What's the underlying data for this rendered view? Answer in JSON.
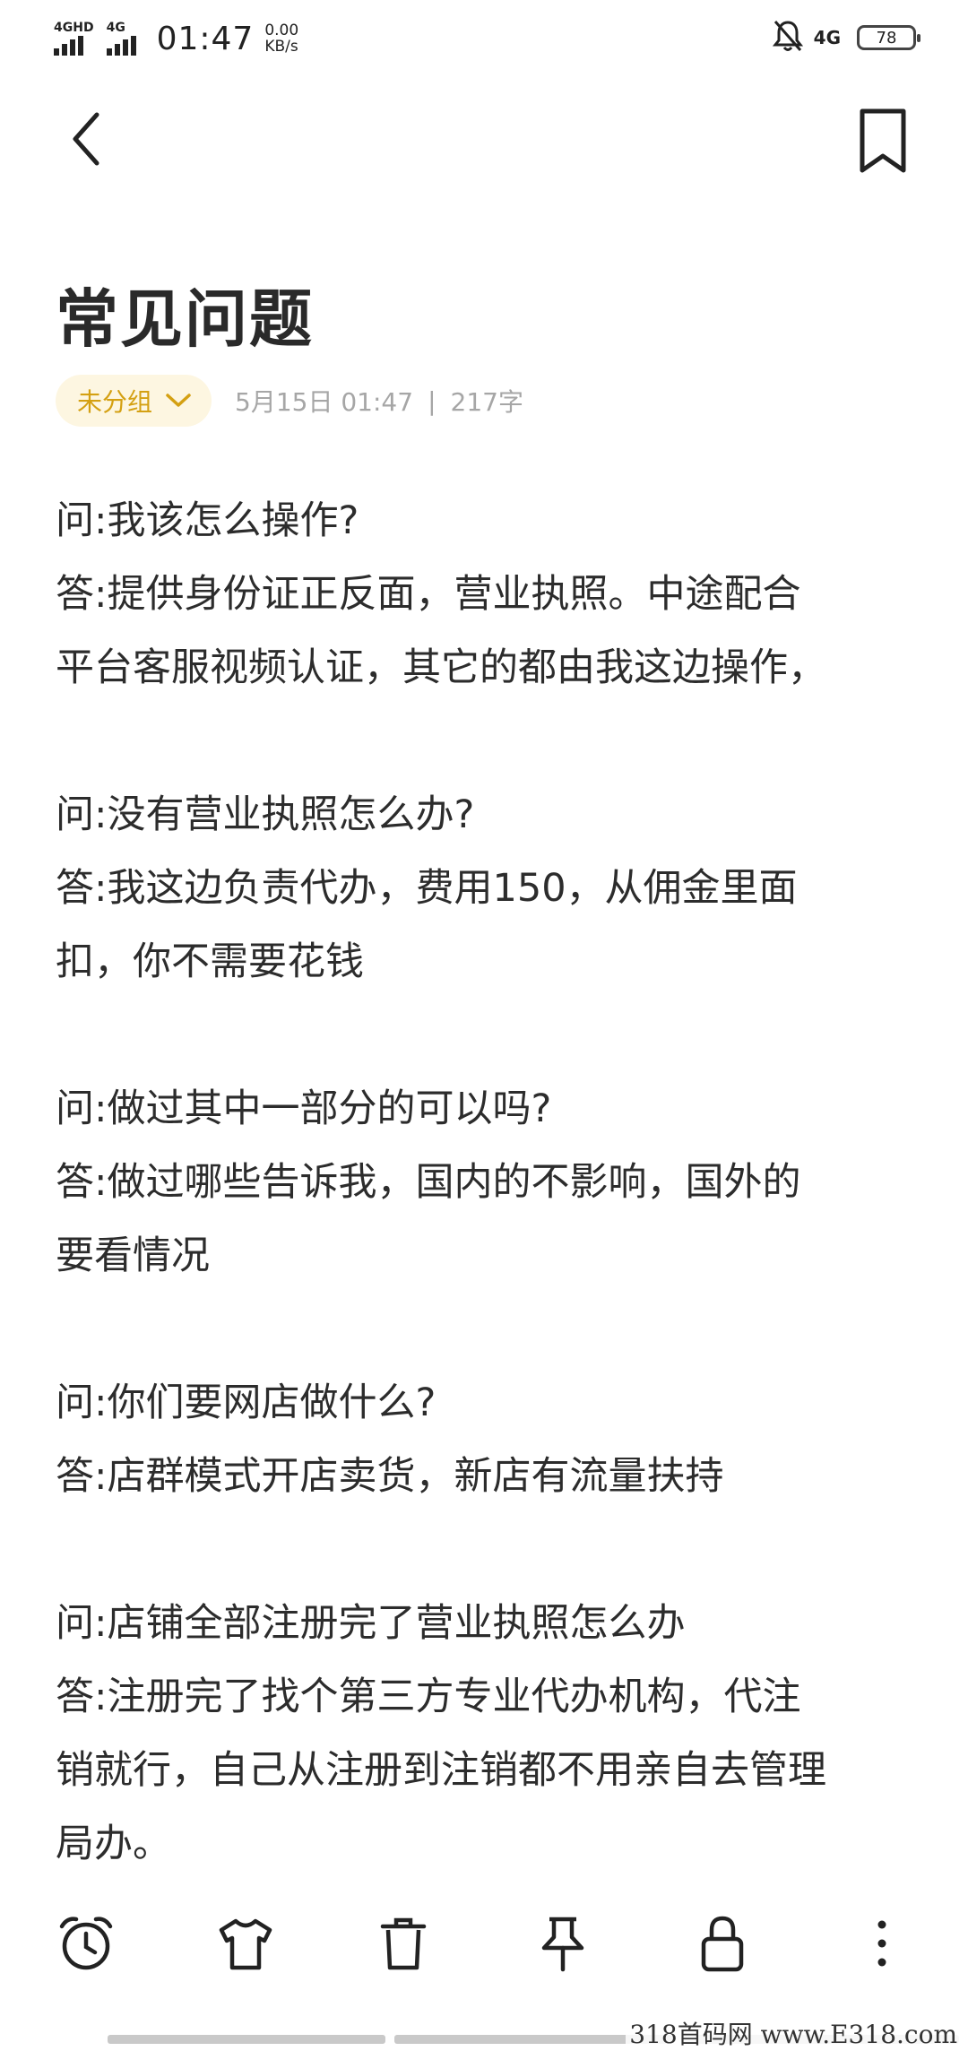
{
  "status_bar": {
    "signal1_label": "4GHD",
    "signal2_label": "4G",
    "time": "01:47",
    "speed_value": "0.00",
    "speed_unit": "KB/s",
    "network_right": "4G",
    "battery": "78"
  },
  "note": {
    "title": "常见问题",
    "group_label": "未分组",
    "date": "5月15日 01:47",
    "separator": "|",
    "word_count": "217字",
    "paragraphs": [
      "问:我该怎么操作?",
      "答:提供身份证正反面，营业执照。中途配合",
      "平台客服视频认证，其它的都由我这边操作，",
      "",
      "问:没有营业执照怎么办?",
      "答:我这边负责代办，费用150，从佣金里面",
      "扣，你不需要花钱",
      "",
      "问:做过其中一部分的可以吗?",
      "答:做过哪些告诉我，国内的不影响，国外的",
      "要看情况",
      "",
      "问:你们要网店做什么?",
      "答:店群模式开店卖货，新店有流量扶持",
      "",
      "问:店铺全部注册完了营业执照怎么办",
      "答:注册完了找个第三方专业代办机构，代注",
      "销就行，自己从注册到注销都不用亲自去管理",
      "局办。"
    ]
  },
  "toolbar_icons": [
    "alarm-icon",
    "shirt-icon",
    "trash-icon",
    "pin-icon",
    "lock-icon",
    "more-icon"
  ],
  "watermark": "318首码网 www.E318.com",
  "colors": {
    "accent": "#d4a012",
    "chip_bg": "#fdf6e1",
    "meta": "#a6a6a6",
    "text": "#2c2c2c"
  }
}
